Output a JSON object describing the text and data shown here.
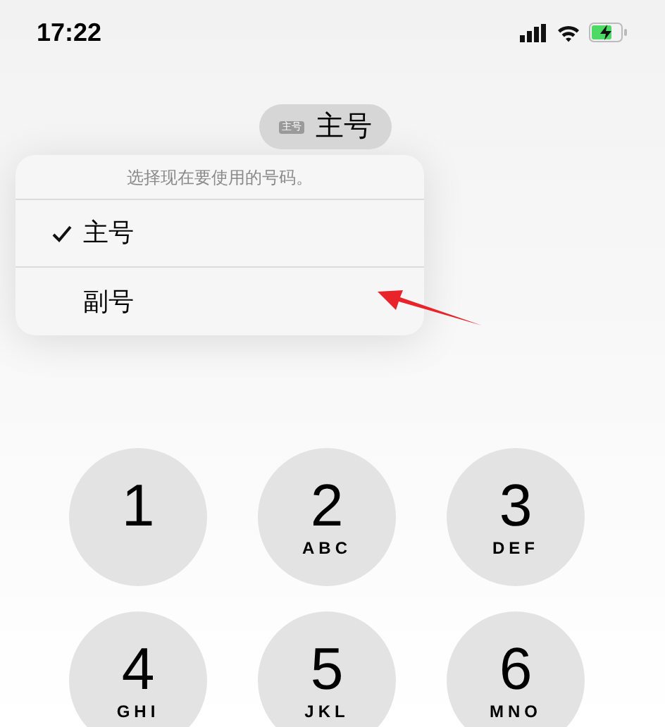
{
  "status_bar": {
    "time": "17:22"
  },
  "line_pill": {
    "badge": "主号",
    "label": "主号"
  },
  "line_menu": {
    "prompt": "选择现在要使用的号码。",
    "options": [
      {
        "label": "主号",
        "selected": true
      },
      {
        "label": "副号",
        "selected": false
      }
    ]
  },
  "keypad": [
    {
      "digit": "1"
    },
    {
      "digit": "2",
      "letters": "ABC"
    },
    {
      "digit": "3",
      "letters": "DEF"
    },
    {
      "digit": "4",
      "letters": "GHI"
    },
    {
      "digit": "5",
      "letters": "JKL"
    },
    {
      "digit": "6",
      "letters": "MNO"
    }
  ]
}
